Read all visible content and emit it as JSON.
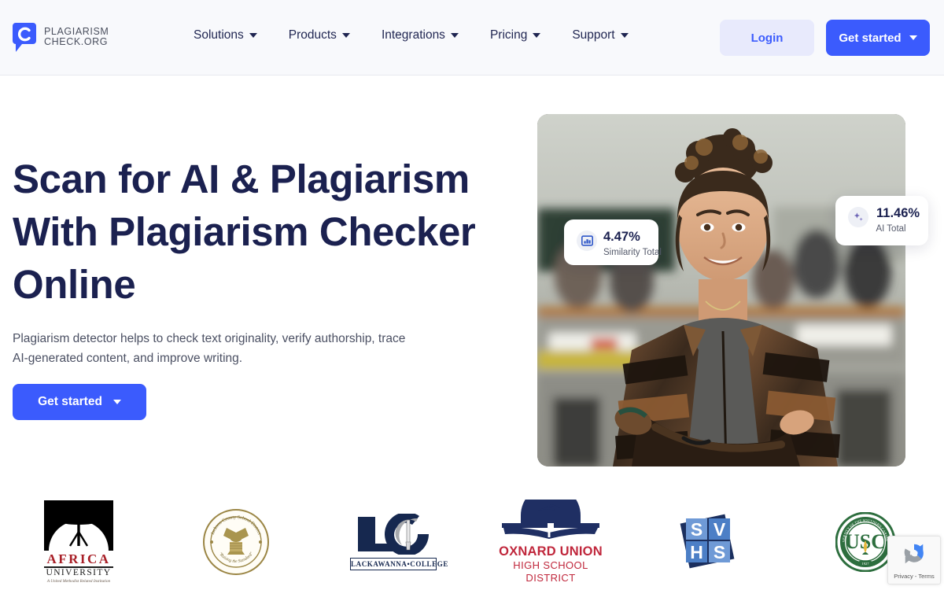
{
  "header": {
    "logo": {
      "icon": "speech-bubble-c-logo",
      "line1": "PLAGIARISM",
      "line2": "CHECK.ORG"
    },
    "nav": [
      {
        "label": "Solutions",
        "has_dropdown": true
      },
      {
        "label": "Products",
        "has_dropdown": true
      },
      {
        "label": "Integrations",
        "has_dropdown": true
      },
      {
        "label": "Pricing",
        "has_dropdown": true
      },
      {
        "label": "Support",
        "has_dropdown": true
      }
    ],
    "login_label": "Login",
    "get_started_label": "Get started"
  },
  "hero": {
    "title_line1": "Scan for AI & Plagiarism",
    "title_line2": "With Plagiarism Checker",
    "title_line3": "Online",
    "subtitle": "Plagiarism detector helps to check text originality, verify authorship, trace AI-generated content, and improve writing.",
    "cta_label": "Get started",
    "image_alt": "smiling-woman-in-classroom",
    "stat_cards": [
      {
        "icon": "bar-chart-icon",
        "value": "4.47%",
        "label": "Similarity Total"
      },
      {
        "icon": "sparkles-icon",
        "value": "11.46%",
        "label": "AI Total"
      }
    ]
  },
  "partners": [
    {
      "name": "africa-university",
      "text": "AFRICA UNIVERSITY",
      "line1": "AFRICA",
      "line2": "UNIVERSITY",
      "line3": "A United Methodist Related Institution"
    },
    {
      "name": "jackson-county-school-district",
      "text": "Jackson County School District",
      "top": "Jackson County School District",
      "bottom": "Raising the Standard"
    },
    {
      "name": "lackawanna-college",
      "text": "LC LACKAWANNA COLLEGE",
      "mono": "LC",
      "bar": "LACKAWANNA•COLLEGE"
    },
    {
      "name": "oxnard-union-high-school-district",
      "text": "OXNARD UNION HIGH SCHOOL DISTRICT",
      "line1": "OXNARD UNION",
      "line2": "HIGH SCHOOL DISTRICT"
    },
    {
      "name": "svhs",
      "text": "SVHS",
      "l1": "S",
      "l2": "V",
      "l3": "H",
      "l4": "S"
    },
    {
      "name": "usc-seal",
      "text": "USC",
      "mono": "USC",
      "year": "1827"
    }
  ],
  "recaptcha": {
    "icon": "recaptcha-icon",
    "label": "Privacy - Terms"
  },
  "colors": {
    "brand_blue": "#3b5bfd",
    "navy": "#1b2150",
    "login_bg": "#e8eafc",
    "header_bg": "#f8f9fc",
    "purple": "#6b63b5"
  }
}
